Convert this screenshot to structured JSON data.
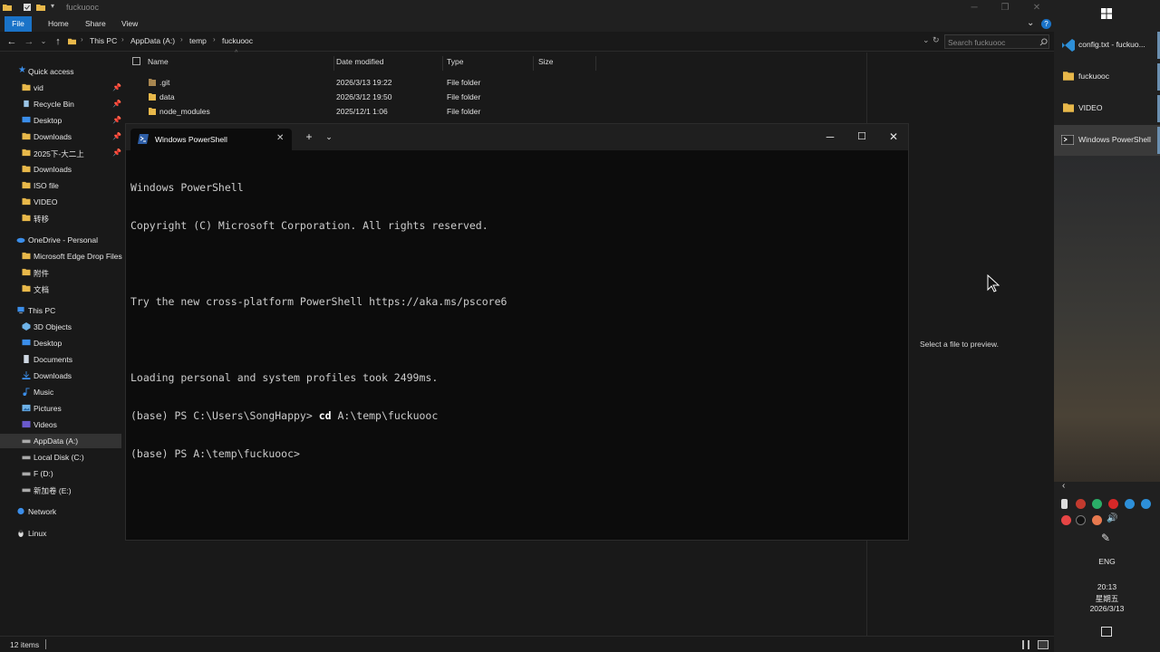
{
  "explorer": {
    "title": "fuckuooc",
    "ribbon_tabs": [
      "File",
      "Home",
      "Share",
      "View"
    ],
    "breadcrumbs": [
      "This PC",
      "AppData (A:)",
      "temp",
      "fuckuooc"
    ],
    "search_placeholder": "Search fuckuooc",
    "nav": {
      "quick_access": "Quick access",
      "quick_items": [
        "vid",
        "Recycle Bin",
        "Desktop",
        "Downloads",
        "2025下-大二上",
        "Downloads",
        "ISO file",
        "VIDEO",
        "转移"
      ],
      "onedrive": "OneDrive - Personal",
      "onedrive_items": [
        "Microsoft Edge Drop Files",
        "附件",
        "文档"
      ],
      "this_pc": "This PC",
      "pc_items": [
        "3D Objects",
        "Desktop",
        "Documents",
        "Downloads",
        "Music",
        "Pictures",
        "Videos",
        "AppData (A:)",
        "Local Disk (C:)",
        "F (D:)",
        "新加卷 (E:)"
      ],
      "network": "Network",
      "linux": "Linux"
    },
    "columns": [
      "Name",
      "Date modified",
      "Type",
      "Size"
    ],
    "files": [
      {
        "name": ".git",
        "date": "2026/3/13 19:22",
        "type": "File folder"
      },
      {
        "name": "data",
        "date": "2026/3/12 19:50",
        "type": "File folder"
      },
      {
        "name": "node_modules",
        "date": "2025/12/1 1:06",
        "type": "File folder"
      }
    ],
    "preview_text": "Select a file to preview.",
    "status_count": "12 items"
  },
  "powershell": {
    "tab_title": "Windows PowerShell",
    "lines": [
      "Windows PowerShell",
      "Copyright (C) Microsoft Corporation. All rights reserved.",
      "",
      "Try the new cross-platform PowerShell https://aka.ms/pscore6",
      "",
      "Loading personal and system profiles took 2499ms."
    ],
    "cmd_prompt": "(base) PS C:\\Users\\SongHappy> ",
    "cmd_word": "cd",
    "cmd_arg": " A:\\temp\\fuckuooc",
    "last_prompt": "(base) PS A:\\temp\\fuckuooc>"
  },
  "taskbar": {
    "apps": [
      "config.txt - fuckuo...",
      "fuckuooc",
      "VIDEO",
      "Windows PowerShell"
    ],
    "language": "ENG",
    "time": "20:13",
    "weekday": "星期五",
    "date": "2026/3/13"
  }
}
